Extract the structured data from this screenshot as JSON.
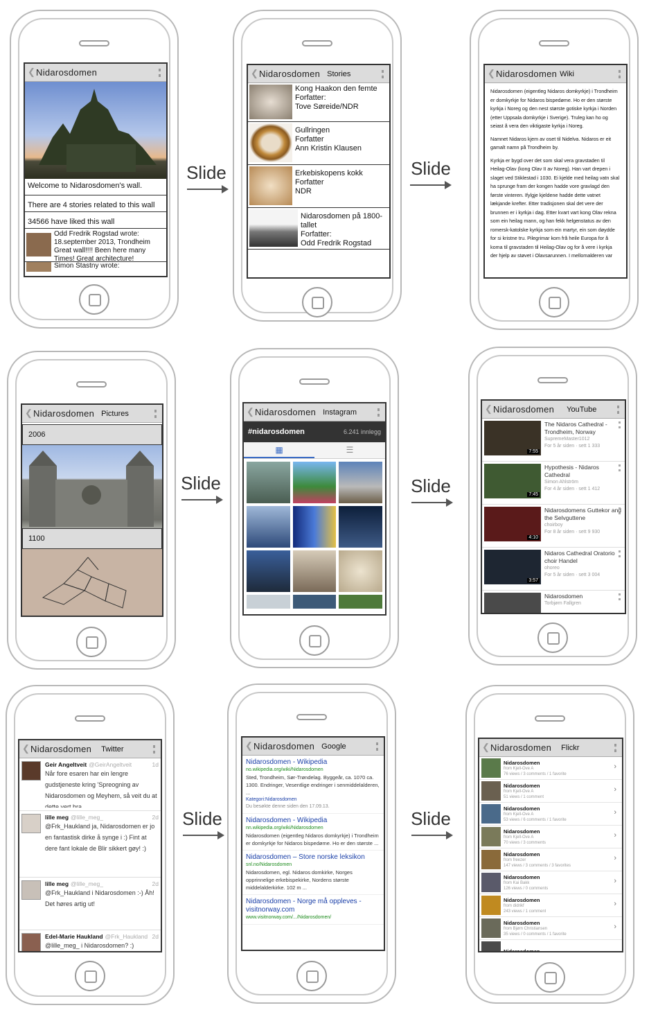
{
  "slide_label": "Slide",
  "app_title": "Nidarosdomen",
  "wall": {
    "welcome": "Welcome to Nidarosdomen's wall.",
    "stories_count": "There are 4 stories related to this wall",
    "likes": "34566 have liked this wall",
    "post1_text": "Odd Fredrik Rogstad wrote: 18.september 2013, Trondheim Great wall!!!! Been here many Times! Great architecture!",
    "post2_text": "Simon Stastny wrote:"
  },
  "stories": {
    "section": "Stories",
    "items": [
      {
        "text": "Kong Haakon den femte\nForfatter:\nTove Søreide/NDR"
      },
      {
        "text": "Gullringen\nForfatter\nAnn Kristin Klausen"
      },
      {
        "text": "Erkebiskopens kokk\nForfatter\nNDR"
      },
      {
        "text": "Nidarosdomen på 1800-\ntallet\nForfatter:\nOdd Fredrik Rogstad"
      }
    ]
  },
  "wiki": {
    "section": "Wiki",
    "p1": "Nidarosdomen (eigentleg Nidaros domkyrkje) i Trondheim er domkyrkje for Nidaros bispedøme. Ho er den største kyrkja i Noreg og den nest største gotiske kyrkja i Norden (etter Uppsala domkyrkje i Sverige). Truleg kan ho og seiast å vera den viktigaste kyrkja i Noreg.",
    "p2": "Namnet Nidaros kjem av oset til Nidelva. Nidaros er eit gamalt namn på Trondheim by.",
    "p3": "Kyrkja er bygd over det som skal vera gravstaden til Heilag-Olav (kong Olav II av Noreg). Han vart drepen i slaget ved Stiklestad i 1030. Ei kjelde med heilag vatn skal ha sprunge fram der kongen hadde vore gravlagd den første vinteren. Ifylgje kjeldene hadde dette vatnet lækjande krefter. Etter tradisjonen skal det vere der brunnen er i kyrkja i dag. Etter kvart vart kong Olav rekna som ein heilag mann, og han fekk helgenstatus av den romersk-katolske kyrkja som ein martyr, ein som døydde for si kristne tru. Pilegrimar kom frå heile Europa for å koma til gravstaden til Heilag-Olav og for å vere i kyrkja der hjelp av støvet i Olavsarunnen. I mellomalderen var"
  },
  "pictures": {
    "section": "Pictures",
    "year1": "2006",
    "year2": "1100"
  },
  "instagram": {
    "section": "Instagram",
    "tag": "#nidarosdomen",
    "count": "6.241 innlegg"
  },
  "youtube": {
    "section": "YouTube",
    "videos": [
      {
        "title": "The Nidaros Cathedral - Trondheim, Norway",
        "meta1": "SupremeMaster1012",
        "meta2": "For 5 år siden · sett 1 333",
        "dur": "7:55"
      },
      {
        "title": "Hypothesis - Nidaros Cathedral",
        "meta1": "Simon Ahlström",
        "meta2": "For 4 år siden · sett 1 412",
        "dur": "7:45"
      },
      {
        "title": "Nidarosdomens Guttekor and the Selvguttene",
        "meta1": "choirboy",
        "meta2": "For 8 år siden · sett 9 930",
        "dur": "4:10"
      },
      {
        "title": "Nidaros Cathedral Oratorio choir Handel",
        "meta1": "ohoreo",
        "meta2": "For 5 år siden · sett 3 004",
        "dur": "3:57"
      },
      {
        "title": "Nidarosdomen",
        "meta1": "Torbjørn Fallgren",
        "meta2": "",
        "dur": ""
      }
    ]
  },
  "twitter": {
    "section": "Twitter",
    "tweets": [
      {
        "name": "Geir Angeltveit",
        "handle": "@GeirAngeltveit",
        "time": "1d",
        "text": "Når fore esaren har ein lengre gudstjeneste kring 'Spreogning av Nidarosdomen og Meyhem, så veit du at dette vert bra."
      },
      {
        "name": "lille meg",
        "handle": "@lille_meg_",
        "time": "2d",
        "text": "@Frk_Haukland ja, Nidarosdomen er jo en fantastisk dirke å synge i :) Fint at dere fant lokale de Blir sikkert gøy! :)"
      },
      {
        "name": "lille meg",
        "handle": "@lille_meg_",
        "time": "2d",
        "text": "@Frk_Haukland i Nidarosdomen :-) Åh! Det høres artig ut!"
      },
      {
        "name": "Edel-Marie Haukland",
        "handle": "@Frk_Haukland",
        "time": "2d",
        "text": "@lille_meg_ i Nidarosdomen? :)"
      }
    ]
  },
  "google": {
    "section": "Google",
    "results": [
      {
        "title": "Nidarosdomen - Wikipedia",
        "url": "no.wikipedia.org/wiki/Nidarosdomen",
        "snippet": "Sted, Trondheim, Sør-Trøndelag. Byggeår, ca. 1070 ca. 1300. Endringer, Vesentlige endringer i senmiddelalderen, ...",
        "extra": "Kategori:Nidarosdomen",
        "note": "Du besøkte denne siden den 17.09.13."
      },
      {
        "title": "Nidarosdomen - Wikipedia",
        "url": "nn.wikipedia.org/wiki/Nidarosdomen",
        "snippet": "Nidarosdomen (eigentleg Nidaros domkyrkje) i Trondheim er domkyrkje for Nidaros bispedøme. Ho er den største ...",
        "extra": "",
        "note": ""
      },
      {
        "title": "Nidarosdomen – Store norske leksikon",
        "url": "snl.no/Nidarosdomen",
        "snippet": "Nidarosdomen, egl. Nidaros domkirke, Norges opprinnelige erkebispekirke, Nordens største middelalderkirke. 102 m ...",
        "extra": "",
        "note": ""
      },
      {
        "title": "Nidarosdomen - Norge må oppleves - visitnorway.com",
        "url": "www.visitnorway.com/.../Nidarosdomen/",
        "snippet": "",
        "extra": "",
        "note": ""
      }
    ]
  },
  "flickr": {
    "section": "Flickr",
    "items": [
      {
        "title": "Nidarosdomen",
        "by": "from Kjell-Ove A",
        "stats": "76 views / 3 comments / 1 favorite"
      },
      {
        "title": "Nidarosdomen",
        "by": "from Kjell-Ove A",
        "stats": "51 views / 1 comment"
      },
      {
        "title": "Nidarosdomen",
        "by": "from Kjell-Ove A",
        "stats": "53 views / 6 comments / 1 favorite"
      },
      {
        "title": "Nidarosdomen",
        "by": "from Kjell-Ove A",
        "stats": "70 views / 3 comments"
      },
      {
        "title": "Nidarosdomen",
        "by": "from freezer",
        "stats": "147 views / 3 comments / 3 favorites"
      },
      {
        "title": "Nidarosdomen",
        "by": "from Kai Bakk",
        "stats": "126 views / 0 comments"
      },
      {
        "title": "Nidarosdomen",
        "by": "from didrikf",
        "stats": "243 views / 1 comment"
      },
      {
        "title": "Nidarosdomen",
        "by": "from Bjørn Christiansen",
        "stats": "35 views / 0 comments / 1 favorite"
      },
      {
        "title": "Nidarosdomen",
        "by": "",
        "stats": ""
      }
    ]
  }
}
